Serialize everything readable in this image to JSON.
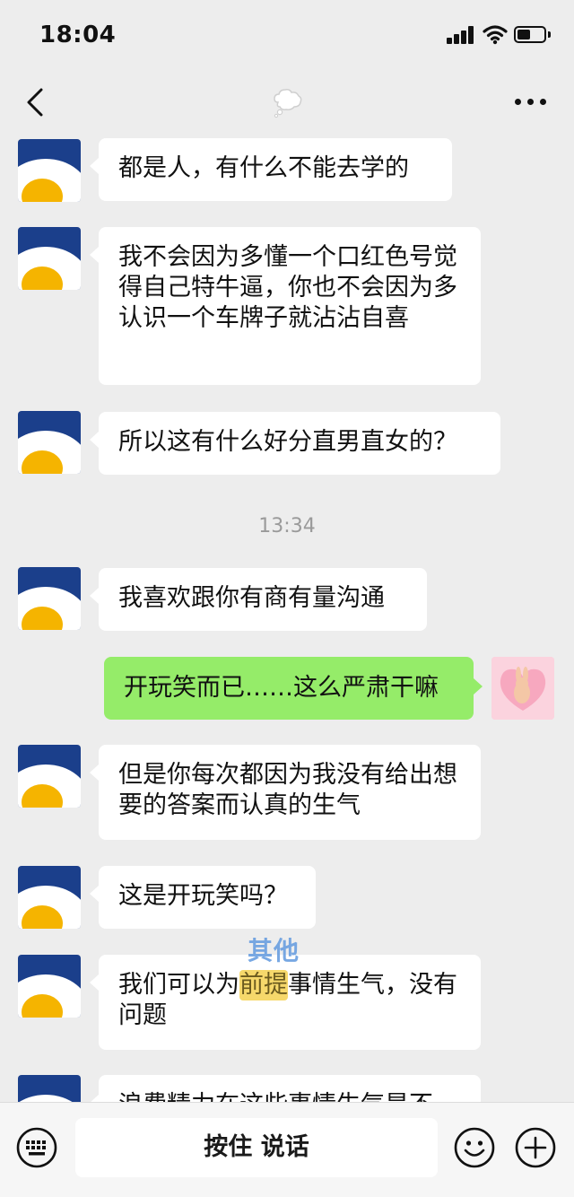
{
  "status_bar": {
    "time": "18:04"
  },
  "nav": {
    "title_icon": "thought-bubble-icon"
  },
  "messages": [
    {
      "side": "left",
      "text": "都是人，有什么不能去学的"
    },
    {
      "side": "left",
      "text": "我不会因为多懂一个口红色号觉得自己特牛逼，你也不会因为多认识一个车牌子就沾沾自喜"
    },
    {
      "side": "left",
      "text": "所以这有什么好分直男直女的？"
    },
    {
      "type": "time",
      "text": "13:34"
    },
    {
      "side": "left",
      "text": "我喜欢跟你有商有量沟通"
    },
    {
      "side": "right",
      "text": "开玩笑而已……这么严肃干嘛"
    },
    {
      "side": "left",
      "text": "但是你每次都因为我没有给出想要的答案而认真的生气"
    },
    {
      "side": "left",
      "text": "这是开玩笑吗？"
    },
    {
      "side": "left",
      "text_before": "我们可以为",
      "text_hidden": "前提",
      "text_after": "事情生气，没有问题"
    },
    {
      "side": "left",
      "text": "浪费精力在这些事情生气是不"
    }
  ],
  "watermark": "其他",
  "input_bar": {
    "hold_to_talk": "按住 说话"
  },
  "colors": {
    "background": "#ededed",
    "my_bubble": "#95ec69",
    "their_bubble": "#ffffff",
    "avatar_bg": "#1b3f8b",
    "avatar_yolk": "#f5b400"
  }
}
